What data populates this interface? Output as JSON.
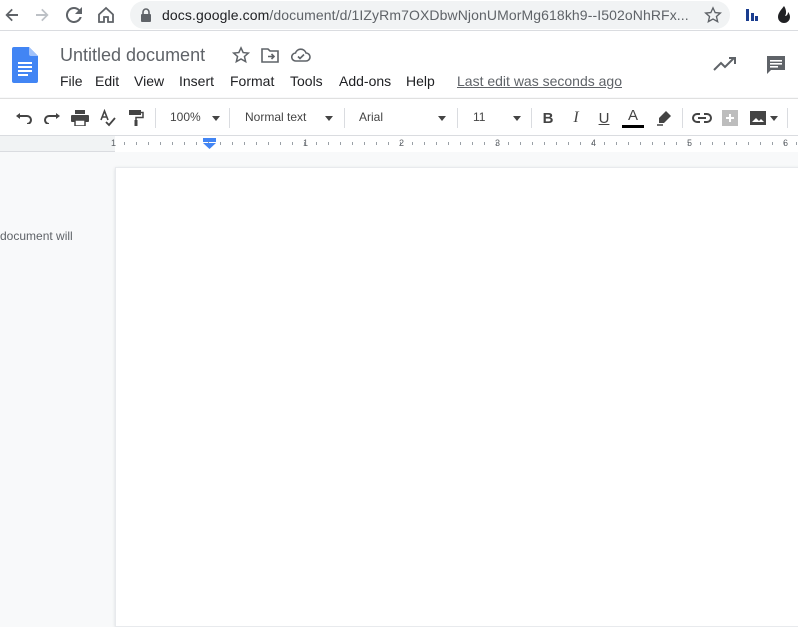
{
  "browser": {
    "url_host": "docs.google.com",
    "url_path": "/document/d/1IZyRm7OXDbwNjonUMorMg618kh9--I502oNhRFx..."
  },
  "doc": {
    "title": "Untitled document",
    "menus": [
      "File",
      "Edit",
      "View",
      "Insert",
      "Format",
      "Tools",
      "Add-ons",
      "Help"
    ],
    "last_edit": "Last edit was seconds ago"
  },
  "toolbar": {
    "zoom": "100%",
    "style": "Normal text",
    "font": "Arial",
    "size": "11",
    "bold": "B",
    "italic": "I",
    "underline": "U",
    "text_color_glyph": "A"
  },
  "ruler": {
    "labels": [
      "1",
      "1",
      "2",
      "3",
      "4",
      "5",
      "6"
    ]
  },
  "outline": {
    "text": "document will"
  },
  "colors": {
    "docs_blue": "#4285f4",
    "indent_marker": "#4285f4",
    "text_color_bar": "#000000"
  }
}
